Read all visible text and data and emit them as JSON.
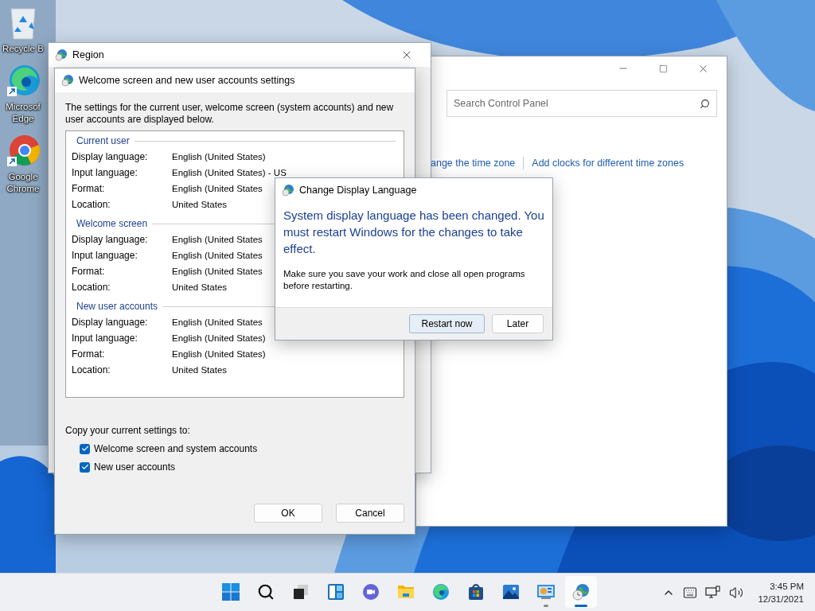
{
  "desktop": {
    "icons": [
      {
        "kind": "recycle",
        "label": [
          "Recycle B"
        ]
      },
      {
        "kind": "edge",
        "label": [
          "Microsof",
          "Edge"
        ]
      },
      {
        "kind": "chrome",
        "label": [
          "Google",
          "Chrome"
        ]
      }
    ]
  },
  "control_panel_window": {
    "search": {
      "placeholder": "Search Control Panel"
    },
    "links": [
      "ange the time zone",
      "Add clocks for different time zones"
    ]
  },
  "region_window": {
    "title": "Region"
  },
  "settings_dialog": {
    "title": "Welcome screen and new user accounts settings",
    "description": "The settings for the current user, welcome screen (system accounts) and new user accounts are displayed below.",
    "sections": [
      {
        "legend": "Current user",
        "rows": [
          {
            "label": "Display language:",
            "value": "English (United States)"
          },
          {
            "label": "Input language:",
            "value": "English (United States) - US"
          },
          {
            "label": "Format:",
            "value": "English (United States"
          },
          {
            "label": "Location:",
            "value": "United States"
          }
        ]
      },
      {
        "legend": "Welcome screen",
        "rows": [
          {
            "label": "Display language:",
            "value": "English (United States"
          },
          {
            "label": "Input language:",
            "value": "English (United States"
          },
          {
            "label": "Format:",
            "value": "English (United States"
          },
          {
            "label": "Location:",
            "value": "United States"
          }
        ]
      },
      {
        "legend": "New user accounts",
        "rows": [
          {
            "label": "Display language:",
            "value": "English (United States"
          },
          {
            "label": "Input language:",
            "value": "English (United States)"
          },
          {
            "label": "Format:",
            "value": "English (United States)"
          },
          {
            "label": "Location:",
            "value": "United States"
          }
        ]
      }
    ],
    "copy_label": "Copy your current settings to:",
    "checkboxes": [
      {
        "label": "Welcome screen and system accounts",
        "checked": true
      },
      {
        "label": "New user accounts",
        "checked": true
      }
    ],
    "buttons": [
      "OK",
      "Cancel"
    ]
  },
  "message_dialog": {
    "title": "Change Display Language",
    "heading": "System display language has been changed. You must restart Windows for the changes to take effect.",
    "body": "Make sure you save your work and close all open programs before restarting.",
    "buttons": [
      {
        "label": "Restart now",
        "focused": true
      },
      {
        "label": "Later",
        "focused": false
      }
    ]
  },
  "taskbar": {
    "apps": [
      {
        "kind": "start",
        "running": false,
        "selected": false
      },
      {
        "kind": "search",
        "running": false,
        "selected": false
      },
      {
        "kind": "taskview",
        "running": false,
        "selected": false
      },
      {
        "kind": "widgets",
        "running": false,
        "selected": false
      },
      {
        "kind": "chat",
        "running": false,
        "selected": false
      },
      {
        "kind": "explorer",
        "running": false,
        "selected": false
      },
      {
        "kind": "edge",
        "running": false,
        "selected": false
      },
      {
        "kind": "store",
        "running": false,
        "selected": false
      },
      {
        "kind": "photos",
        "running": false,
        "selected": false
      },
      {
        "kind": "controlpanel",
        "running": true,
        "selected": false
      },
      {
        "kind": "region",
        "running": true,
        "selected": true
      }
    ],
    "time": "3:45 PM",
    "date": "12/31/2021"
  }
}
